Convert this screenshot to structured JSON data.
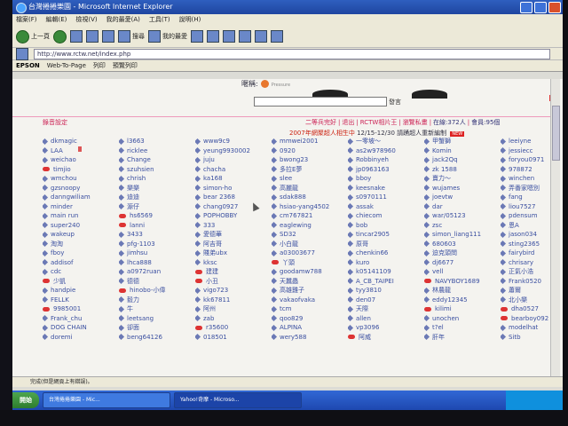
{
  "window": {
    "title": "台灣捲捲樂園 - Microsoft Internet Explorer"
  },
  "menu": [
    "檔案(F)",
    "編輯(E)",
    "檢視(V)",
    "我的最愛(A)",
    "工具(T)",
    "說明(H)"
  ],
  "toolbar": {
    "back": "上一頁",
    "search": "搜尋",
    "favorites": "我的最愛"
  },
  "address": {
    "value": "http://www.rctw.net/index.php"
  },
  "epson": {
    "brand": "EPSON",
    "web_to_page": "Web-To-Page",
    "print": "列印",
    "preview": "預覽列印"
  },
  "page": {
    "nickname_label": "暱稱:",
    "nickname_small": "Pressure",
    "send_label": "發言",
    "left_link": "錄音設定",
    "right_links": [
      "二等兵完好",
      "|",
      "退出",
      "|",
      "RCTW相片王",
      "|",
      "瀏覽私畫",
      "|",
      "在線:372人",
      "|",
      "會員:95個"
    ],
    "announce_red": "2007年網聚超人相生中",
    "announce_black": "12/15-12/30 請踴超人重新編制",
    "announce_tag": "NEW"
  },
  "users": [
    [
      "dkmagic",
      "LAA",
      "weichao",
      "timjio",
      "wmchou",
      "gzsnoopy",
      "danngwiliam",
      "minder",
      "main run",
      "super240",
      "wakeup",
      "淘淘",
      "fboy",
      "addisof",
      "cdc",
      "少凱",
      "handpie",
      "FELLK",
      "9985001",
      "Frank_chu",
      "DOG CHAIN",
      "doremi"
    ],
    [
      "l3663",
      "ricklee",
      "Change",
      "szuhsien",
      "chrish",
      "樂樂",
      "迪迪",
      "源仔",
      "hs6569",
      "lanni",
      "3433",
      "pfg-1103",
      "jimhsu",
      "lhca888",
      "a0972ruan",
      "德德",
      "hinobo-小偉",
      "毅力",
      "牛",
      "leetsang",
      "卻面",
      "beng64126"
    ],
    [
      "www9c9",
      "yeung9930002",
      "juju",
      "chacha",
      "ka168",
      "simon-ho",
      "bear 2368",
      "chang0927",
      "POPHOBBY",
      "333",
      "愛德華",
      "阿吉哥",
      "賤弟ubx",
      "kksc",
      "建建",
      "小丑",
      "vigo723",
      "kk67811",
      "阿州",
      "zab",
      "r35600",
      "018501"
    ],
    [
      "mmwei2001",
      "0920",
      "bwong23",
      "多拉E夢",
      "slee",
      "高麗龍",
      "sdak888",
      "hsiao-yang4502",
      "cm767821",
      "eaglewing",
      "SD32",
      "小白龍",
      "a03003677",
      "丫頭",
      "goodamw788",
      "天蠶蟲",
      "高雄雞子",
      "vakaofvaka",
      "tcm",
      "qoo829",
      "ALPINA",
      "wery588"
    ],
    [
      "一零坡～",
      "as2w978960",
      "Robbinyeh",
      "jp0963163",
      "bboy",
      "keesnake",
      "s0970111",
      "assak",
      "chiecom",
      "bob",
      "tincar2905",
      "原哥",
      "chenkin66",
      "kuro",
      "k05141109",
      "A_CB_TAIPEI",
      "tyy3810",
      "den07",
      "天際",
      "allen",
      "vp3096",
      "阿威"
    ],
    [
      "甲蟹獅",
      "Komin",
      "jack2Qq",
      "zk 1588",
      "賣力～",
      "wujames",
      "joevtw",
      "dar",
      "war/05123",
      "zsc",
      "simon_liang111",
      "680603",
      "迫克頭問",
      "dj6677",
      "vell",
      "NAVYBOY1689",
      "林農龍",
      "eddy12345",
      "kilimi",
      "unochen",
      "t?el",
      "肝年"
    ],
    [
      "leeiyne",
      "jessiecc",
      "foryou0971",
      "978872",
      "winchen",
      "弄番家嗯別",
      "fang",
      "liou7527",
      "pdensum",
      "恩A",
      "jason034",
      "sting2365",
      "fairybird",
      "chrisary",
      "正氣小浩",
      "Frank0520",
      "蕭爾",
      "北小樂",
      "dha0527",
      "bearboy092",
      "modelhat",
      "Sitb"
    ]
  ],
  "red_icons": [
    [
      3,
      15,
      18
    ],
    [
      8,
      9,
      16
    ],
    [
      14,
      15,
      20
    ],
    [
      13
    ],
    [
      21
    ],
    [
      15,
      18
    ],
    [
      18,
      19
    ]
  ],
  "status": {
    "text": "完成(但是網頁上有錯誤)。"
  },
  "taskbar": {
    "start": "開始",
    "task1": "台灣捲捲樂園 - Mic...",
    "task2": "Yahoo!奇摩 - Microso...",
    "clock": ""
  }
}
